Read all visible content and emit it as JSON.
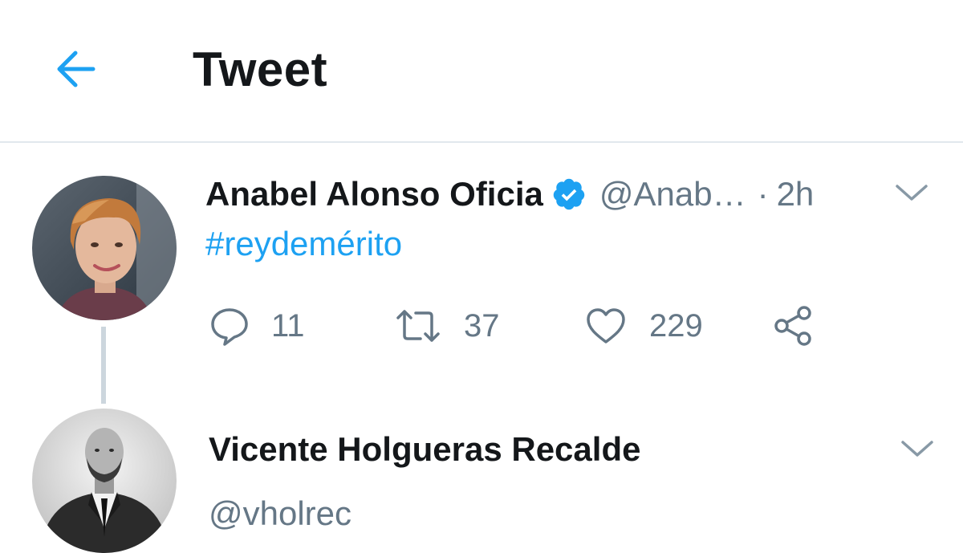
{
  "header": {
    "title": "Tweet",
    "back_icon": "arrow-left-icon"
  },
  "colors": {
    "accent": "#1da1f2",
    "text_primary": "#14171a",
    "text_secondary": "#657786",
    "divider": "#e1e8ed"
  },
  "tweet": {
    "display_name": "Anabel Alonso Oficia",
    "verified_icon": "verified-badge-icon",
    "handle": "@Anab…",
    "separator": "·",
    "time": "2h",
    "text": "#reydemérito",
    "actions": {
      "reply": {
        "icon": "reply-icon",
        "count": "11"
      },
      "retweet": {
        "icon": "retweet-icon",
        "count": "37"
      },
      "like": {
        "icon": "heart-icon",
        "count": "229"
      },
      "share": {
        "icon": "share-icon"
      }
    },
    "menu_icon": "chevron-down-icon"
  },
  "reply": {
    "display_name": "Vicente Holgueras Recalde",
    "handle": "@vholrec",
    "menu_icon": "chevron-down-icon"
  }
}
